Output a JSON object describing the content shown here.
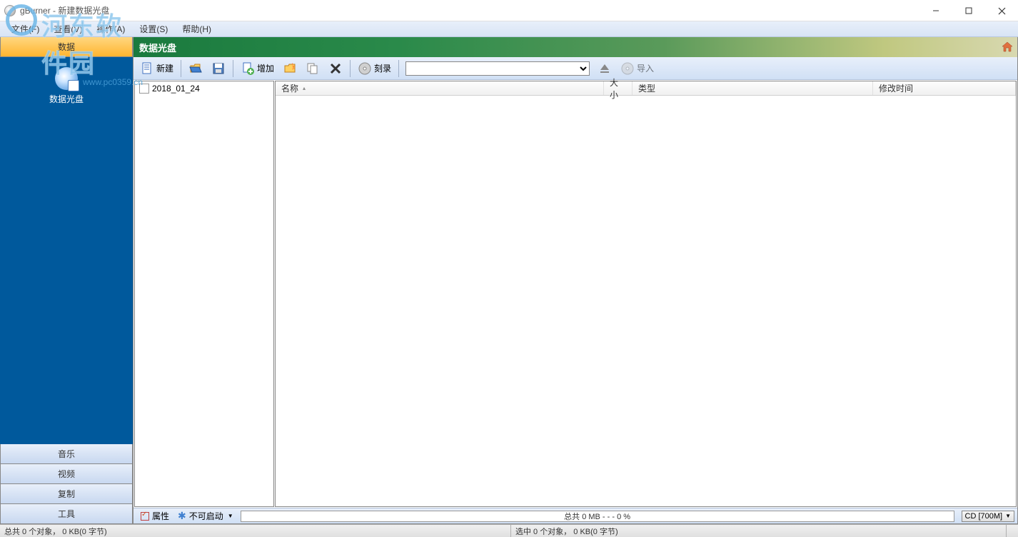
{
  "window": {
    "title": "gBurner - 新建数据光盘"
  },
  "menu": {
    "file": "文件(F)",
    "view": "查看(V)",
    "action": "操作(A)",
    "settings": "设置(S)",
    "help": "帮助(H)"
  },
  "watermark": {
    "main": "河东软件园",
    "sub": "www.pc0359.cn"
  },
  "sidebar": {
    "tabs": {
      "data": "数据",
      "music": "音乐",
      "video": "视频",
      "copy": "复制",
      "tools": "工具"
    },
    "item_data_disc": "数据光盘"
  },
  "header": {
    "title": "数据光盘"
  },
  "toolbar": {
    "new": "新建",
    "add": "增加",
    "burn": "刻录",
    "import": "导入"
  },
  "tree": {
    "root": "2018_01_24"
  },
  "columns": {
    "name": "名称",
    "size": "大小",
    "type": "类型",
    "modified": "修改时间"
  },
  "inner_status": {
    "properties": "属性",
    "autorun": "不可启动",
    "progress": "总共  0 MB  - - -  0 %",
    "media": "CD [700M]"
  },
  "statusbar": {
    "left": "总共 0 个对象， 0 KB(0 字节)",
    "right": "选中 0 个对象， 0 KB(0 字节)"
  }
}
